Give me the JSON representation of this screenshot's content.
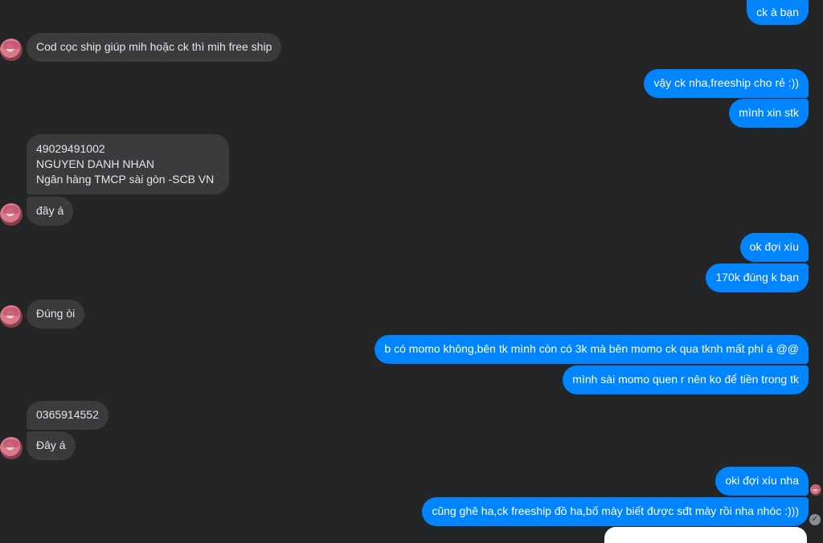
{
  "conversation": {
    "messages": [
      {
        "side": "out",
        "text": "ck à bạn"
      },
      {
        "side": "in",
        "text": "Cod cọc ship giúp mih hoặc ck thì mih free ship"
      },
      {
        "side": "out",
        "text": "vậy ck nha,freeship cho rẻ :))"
      },
      {
        "side": "out",
        "text": "mình xin stk"
      },
      {
        "side": "in",
        "lines": [
          "49029491002",
          "NGUYEN DANH NHAN",
          "Ngân hàng TMCP sài gòn -SCB VN"
        ]
      },
      {
        "side": "in",
        "text": "đây á"
      },
      {
        "side": "out",
        "text": "ok đợi xíu"
      },
      {
        "side": "out",
        "text": "170k đúng k bạn"
      },
      {
        "side": "in",
        "text": "Đúng òi"
      },
      {
        "side": "out",
        "text": "b có momo không,bên tk mình còn có 3k mà bên momo ck qua tknh mất phí á @@"
      },
      {
        "side": "out",
        "text": "mình sài momo quen r nên ko để tiền trong tk"
      },
      {
        "side": "in",
        "text": "0365914552"
      },
      {
        "side": "in",
        "text": "Đây á"
      },
      {
        "side": "out",
        "text": "oki đợi xíu nha"
      },
      {
        "side": "out",
        "text": "cũng ghê ha,ck freeship đồ ha,bố mày biết được sđt mày rồi nha nhóc :)))"
      }
    ]
  },
  "colors": {
    "background": "#242526",
    "incoming_bubble": "#3a3b3c",
    "outgoing_bubble": "#0084ff"
  },
  "icons": {
    "contact_avatar": "avatar",
    "seen_indicator": "avatar",
    "delivered_indicator": "check-circle-icon"
  }
}
